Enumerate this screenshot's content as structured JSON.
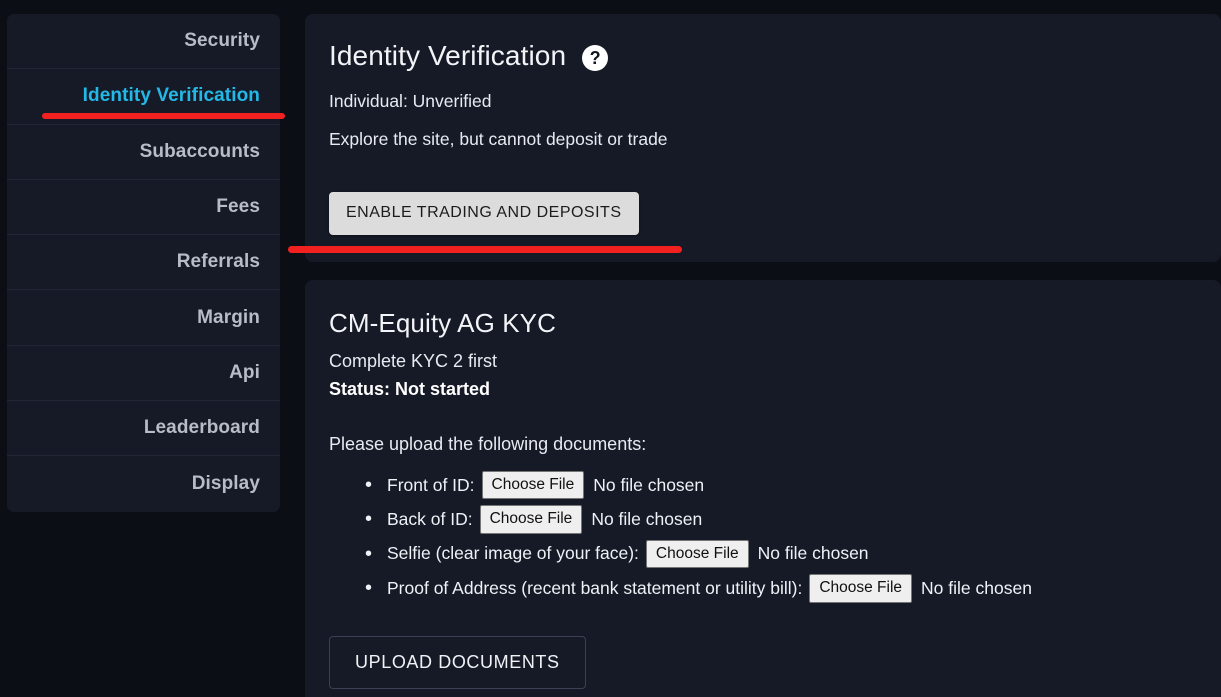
{
  "sidebar": {
    "items": [
      {
        "label": "Security",
        "active": false
      },
      {
        "label": "Identity Verification",
        "active": true
      },
      {
        "label": "Subaccounts",
        "active": false
      },
      {
        "label": "Fees",
        "active": false
      },
      {
        "label": "Referrals",
        "active": false
      },
      {
        "label": "Margin",
        "active": false
      },
      {
        "label": "Api",
        "active": false
      },
      {
        "label": "Leaderboard",
        "active": false
      },
      {
        "label": "Display",
        "active": false
      }
    ]
  },
  "identity": {
    "title": "Identity Verification",
    "help_icon": "question-mark-icon",
    "status": "Individual: Unverified",
    "description": "Explore the site, but cannot deposit or trade",
    "enable_button": "ENABLE TRADING AND DEPOSITS"
  },
  "kyc": {
    "title": "CM-Equity AG KYC",
    "subtitle": "Complete KYC 2 first",
    "status": "Status: Not started",
    "upload_intro": "Please upload the following documents:",
    "documents": [
      {
        "label": "Front of ID:",
        "button": "Choose File",
        "file_status": "No file chosen"
      },
      {
        "label": "Back of ID:",
        "button": "Choose File",
        "file_status": "No file chosen"
      },
      {
        "label": "Selfie (clear image of your face):",
        "button": "Choose File",
        "file_status": "No file chosen"
      },
      {
        "label": "Proof of Address (recent bank statement or utility bill):",
        "button": "Choose File",
        "file_status": "No file chosen"
      }
    ],
    "upload_button": "UPLOAD DOCUMENTS"
  },
  "annotations": {
    "highlight_color": "#f32020",
    "nav_underline": "identity-verification-underline",
    "button_underline": "enable-trading-underline"
  },
  "colors": {
    "page_background": "#0b0e15",
    "card_background": "#151a26",
    "active_nav": "#22b8e8",
    "nav_text": "#b7bcc6",
    "body_text": "#e7eaf0"
  }
}
